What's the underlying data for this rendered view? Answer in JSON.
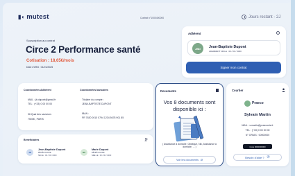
{
  "header": {
    "logo_text": "mutest",
    "contract_number": "Contrat n°1000400000",
    "days_remaining": "Jours restant - 2J"
  },
  "subscription": {
    "label": "Souscription au contrat",
    "title": "Circe 2 Performance santé",
    "price": "Cotisation : 18,65€/mois",
    "effective_date": "Date d'effet : 01/01/2025"
  },
  "adherent": {
    "title": "Adhérent",
    "avatar_initials": "JBD",
    "name": "Jean-Baptiste Dupont",
    "subtitle": "ADHÉRENT NÉ LE : 00 / 00 / 0000",
    "sign_button": "Signer mon contrat"
  },
  "coordinates": {
    "title": "Coordonnées Adhérent",
    "mail": "MAIL : jb.dupont@gmail.fr",
    "tel": "TEL : (+33) 0 00 00 00",
    "address_line1": "36 Quai des sauveurs",
    "address_line2": "75008 , PARIS"
  },
  "banking": {
    "title": "Coordonnées bancaires",
    "holder_label": "Titulaire du compte :",
    "holder_name": "JEAN-BAPTISTE DUPONT",
    "iban_label": "IBAN :",
    "iban": "FR 7630 0010 0794 1234 5678 901 85"
  },
  "beneficiaries": {
    "title": "Bénéficiaires",
    "items": [
      {
        "initials": "JB",
        "name": "Jean-Baptiste Dupont",
        "role": "BÉNÉFICIAIRE",
        "dob": "NÉ LE : 00 / 00 / 0000"
      },
      {
        "initials": "MD",
        "name": "Marie Dupont",
        "role": "BÉNÉFICIAIRE",
        "dob": "NÉE LE : 00 / 00 / 0000"
      }
    ]
  },
  "documents": {
    "title": "Documents",
    "headline": "Vos 8 documents sont disponible ici :",
    "categories": "( Assistance à domicile, Obsèque, Nic, Assistance à domicile, ... )",
    "button": "Voir les documents"
  },
  "courtier": {
    "title": "Courtier",
    "company": "Praeco",
    "name": "Sylvain Martin",
    "mail": "MAIL : s.martin@praeconis.fr",
    "tel": "TEL : (+33) 0 00 00 00",
    "orias": "N° ORIAS : 00000000",
    "code": "Code 0000000000",
    "help_button": "Besoin d'aide ?"
  },
  "colors": {
    "accent": "#2f5fb3",
    "price": "#e15c3e",
    "navy": "#1c2440"
  }
}
